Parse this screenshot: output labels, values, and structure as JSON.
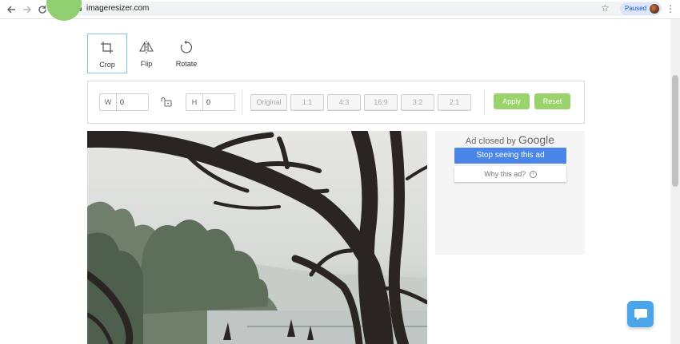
{
  "browser": {
    "url": "imageresizer.com",
    "profile_status": "Paused"
  },
  "tools": [
    {
      "label": "Crop",
      "icon": "crop-icon",
      "active": true
    },
    {
      "label": "Flip",
      "icon": "flip-icon",
      "active": false
    },
    {
      "label": "Rotate",
      "icon": "rotate-icon",
      "active": false
    }
  ],
  "options": {
    "width_prefix": "W",
    "width_value": "0",
    "height_prefix": "H",
    "height_value": "0",
    "ratios": [
      "Original",
      "1:1",
      "4:3",
      "16:9",
      "3:2",
      "2:1"
    ],
    "apply_label": "Apply",
    "reset_label": "Reset"
  },
  "ad": {
    "closed_by": "Ad closed by",
    "google": "Google",
    "stop_label": "Stop seeing this ad",
    "why_label": "Why this ad?"
  },
  "colors": {
    "accent_green": "#9ad36b",
    "ad_blue": "#4a86e8",
    "chat_blue": "#4aa6e8"
  }
}
